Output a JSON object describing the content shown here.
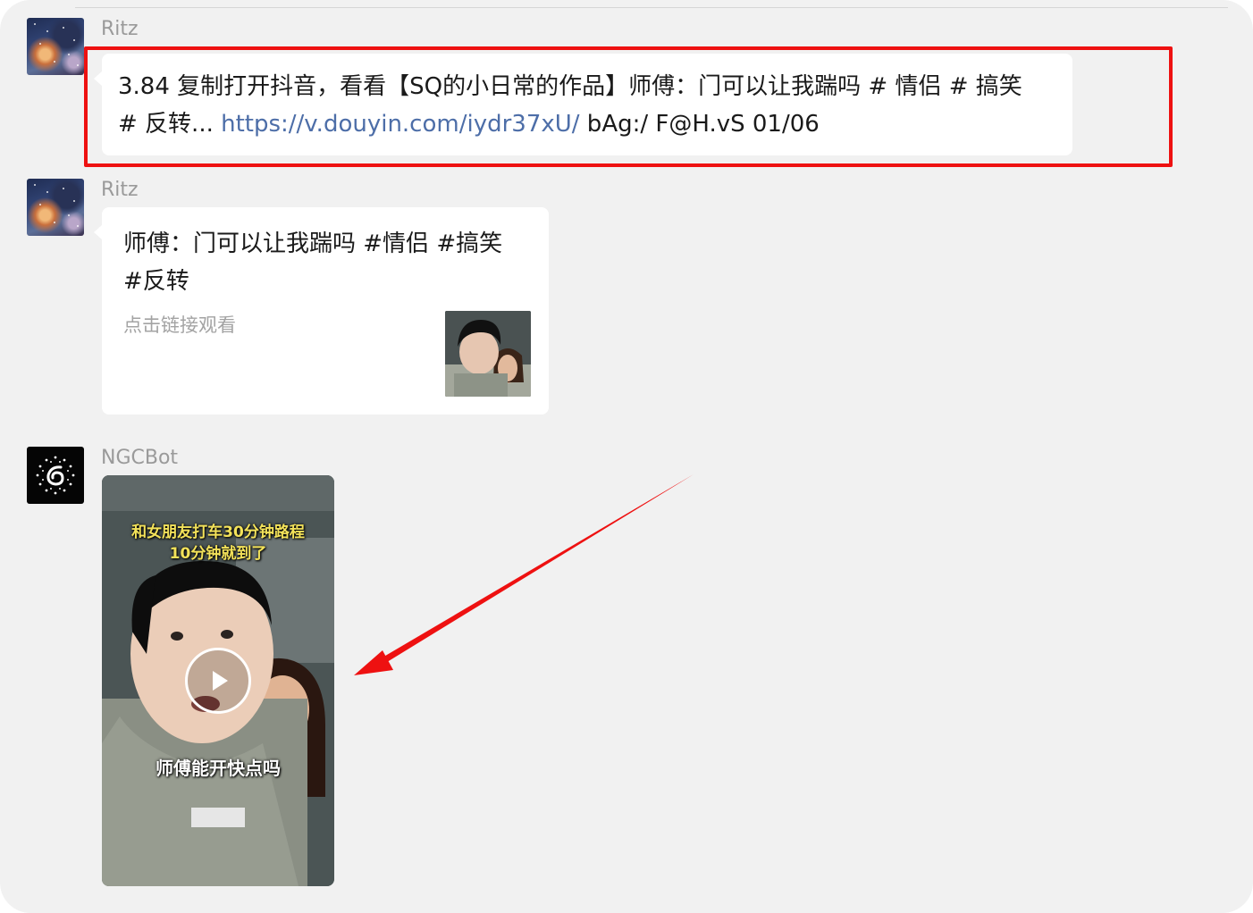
{
  "messages": [
    {
      "sender": "Ritz",
      "avatar_icon": "starry-night-avatar-icon",
      "text_line1": "3.84 复制打开抖音，看看【SQ的小日常的作品】师傅：门可以让我踹吗 # 情侣 # 搞笑",
      "text_line2_prefix": "# 反转... ",
      "link": "https://v.douyin.com/iydr37xU/",
      "text_line2_suffix": " bAg:/ F@H.vS 01/06"
    },
    {
      "sender": "Ritz",
      "avatar_icon": "starry-night-avatar-icon",
      "card_title_line1": "师傅：门可以让我踹吗 #情侣 #搞笑",
      "card_title_line2": "#反转",
      "card_subtitle": "点击链接观看",
      "thumbnail_icon": "video-thumbnail-image"
    },
    {
      "sender": "NGCBot",
      "avatar_icon": "ngcbot-logo-icon",
      "video_caption_line1": "和女朋友打车30分钟路程",
      "video_caption_line2": "10分钟就到了",
      "video_subtitle": "师傅能开快点吗",
      "play_icon": "play-icon"
    }
  ],
  "annotations": {
    "highlight_color": "#ee1111",
    "arrow_color": "#ee1111"
  },
  "colors": {
    "background": "#f1f1f1",
    "bubble": "#ffffff",
    "link": "#4d6ea8",
    "sender_name": "#9a9a9a"
  }
}
